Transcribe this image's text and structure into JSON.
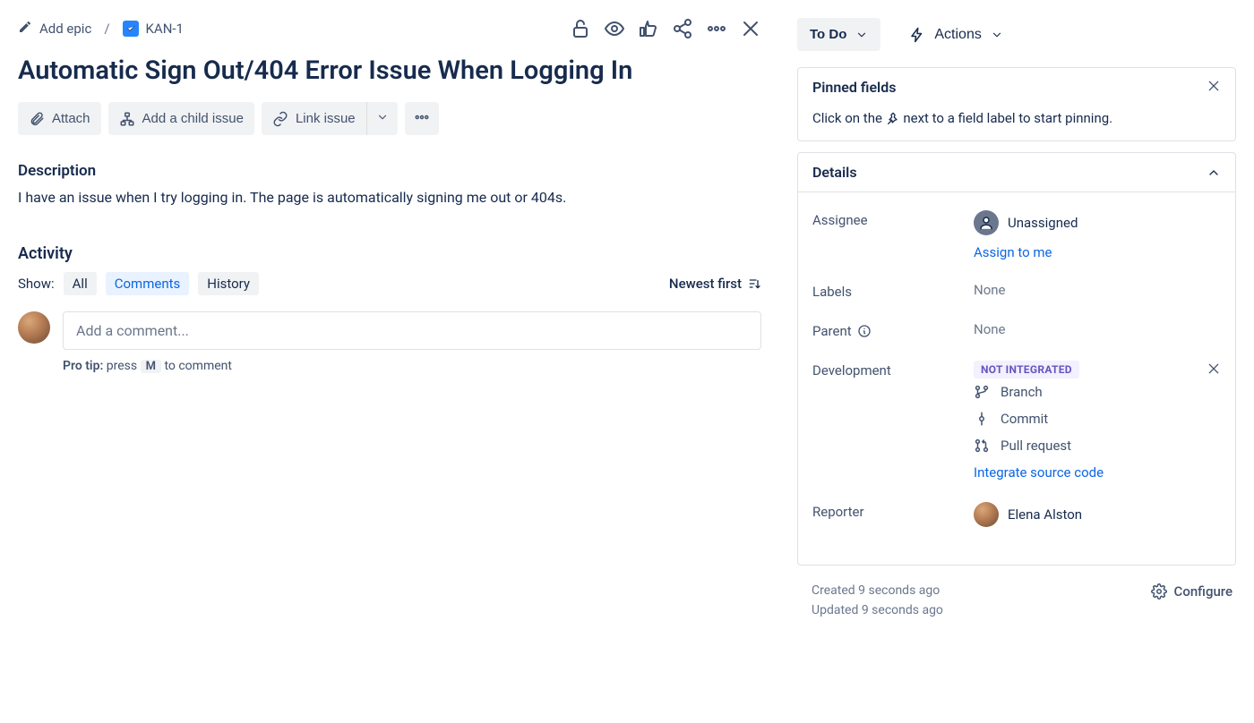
{
  "breadcrumb": {
    "add_epic": "Add epic",
    "issue_key": "KAN-1"
  },
  "title": "Automatic Sign Out/404 Error Issue When Logging In",
  "actions": {
    "attach": "Attach",
    "add_child": "Add a child issue",
    "link_issue": "Link issue"
  },
  "description": {
    "heading": "Description",
    "text": "I have an issue when I try logging in. The page is automatically signing me out or 404s."
  },
  "activity": {
    "heading": "Activity",
    "show_label": "Show:",
    "tabs": {
      "all": "All",
      "comments": "Comments",
      "history": "History"
    },
    "sort_label": "Newest first",
    "comment_placeholder": "Add a comment...",
    "protip_prefix": "Pro tip:",
    "protip_press": "press",
    "protip_key": "M",
    "protip_suffix": "to comment"
  },
  "side": {
    "status_label": "To Do",
    "actions_label": "Actions",
    "pinned": {
      "title": "Pinned fields",
      "hint_a": "Click on the ",
      "hint_b": " next to a field label to start pinning."
    },
    "details_title": "Details",
    "fields": {
      "assignee_label": "Assignee",
      "assignee_value": "Unassigned",
      "assign_to_me": "Assign to me",
      "labels_label": "Labels",
      "labels_value": "None",
      "parent_label": "Parent",
      "parent_value": "None",
      "development_label": "Development",
      "dev_badge": "NOT INTEGRATED",
      "branch": "Branch",
      "commit": "Commit",
      "pull_request": "Pull request",
      "integrate": "Integrate source code",
      "reporter_label": "Reporter",
      "reporter_value": "Elena Alston"
    },
    "footer": {
      "created": "Created 9 seconds ago",
      "updated": "Updated 9 seconds ago",
      "configure": "Configure"
    }
  }
}
